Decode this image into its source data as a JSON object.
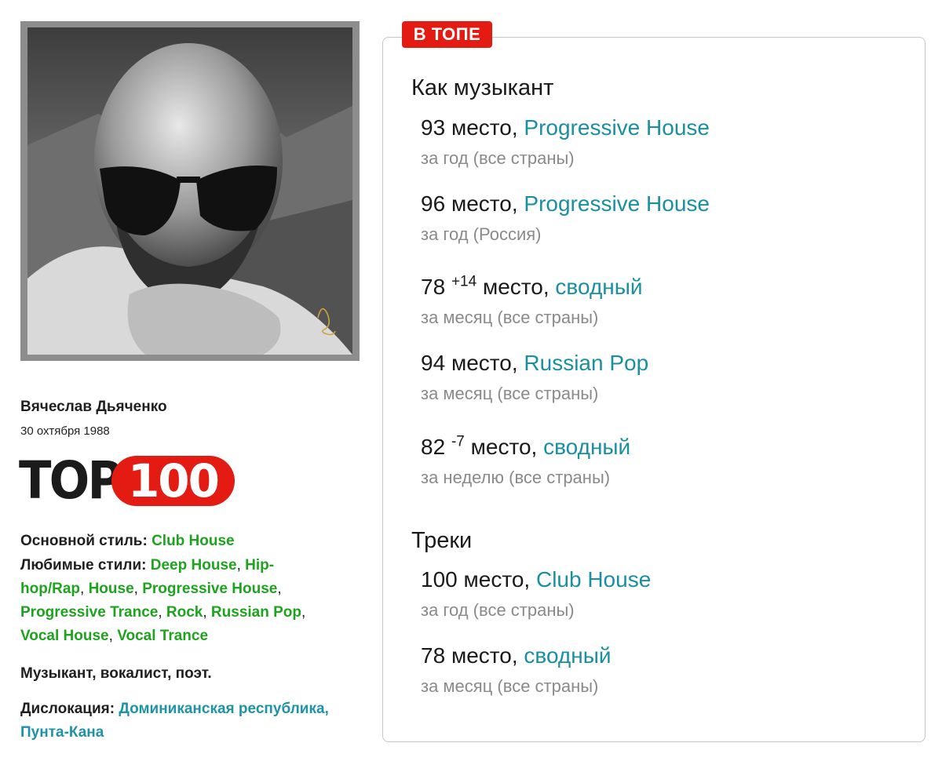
{
  "artist": {
    "name": "Вячеслав Дьяченко",
    "birthdate": "30 охтября 1988",
    "logo": {
      "top_word": "TOP",
      "number": "100"
    },
    "main_style_label": "Основной стиль:",
    "main_style": "Club House",
    "fav_styles_label": "Любимые стили:",
    "fav_styles": [
      "Deep House",
      "Hip-hop/Rap",
      "House",
      "Progressive House",
      "Progressive Trance",
      "Rock",
      "Russian Pop",
      "Vocal House",
      "Vocal Trance"
    ],
    "role": "Музыкант, вокалист, поэт.",
    "location_label": "Дислокация:",
    "location": "Доминиканская республика, Пунта-Кана"
  },
  "panel": {
    "badge": "В ТОПЕ",
    "sections": [
      {
        "title": "Как музыкант",
        "entries": [
          {
            "rank": "93",
            "change": "",
            "word": "место,",
            "genre": "Progressive House",
            "period": "за год (все страны)"
          },
          {
            "rank": "96",
            "change": "",
            "word": "место,",
            "genre": "Progressive House",
            "period": "за год (Россия)"
          },
          {
            "rank": "78",
            "change": "+14",
            "word": "место,",
            "genre": "сводный",
            "period": "за месяц (все страны)"
          },
          {
            "rank": "94",
            "change": "",
            "word": "место,",
            "genre": "Russian Pop",
            "period": "за месяц (все страны)"
          },
          {
            "rank": "82",
            "change": "-7",
            "word": "место,",
            "genre": "сводный",
            "period": "за неделю (все страны)"
          }
        ]
      },
      {
        "title": "Треки",
        "entries": [
          {
            "rank": "100",
            "change": "",
            "word": "место,",
            "genre": "Club House",
            "period": "за год (все страны)"
          },
          {
            "rank": "78",
            "change": "",
            "word": "место,",
            "genre": "сводный",
            "period": "за месяц (все страны)"
          }
        ]
      }
    ]
  },
  "colors": {
    "accent_red": "#e41b13",
    "link_green": "#1ea31e",
    "link_teal": "#1f93a6",
    "muted_text": "#8a8a8a"
  }
}
